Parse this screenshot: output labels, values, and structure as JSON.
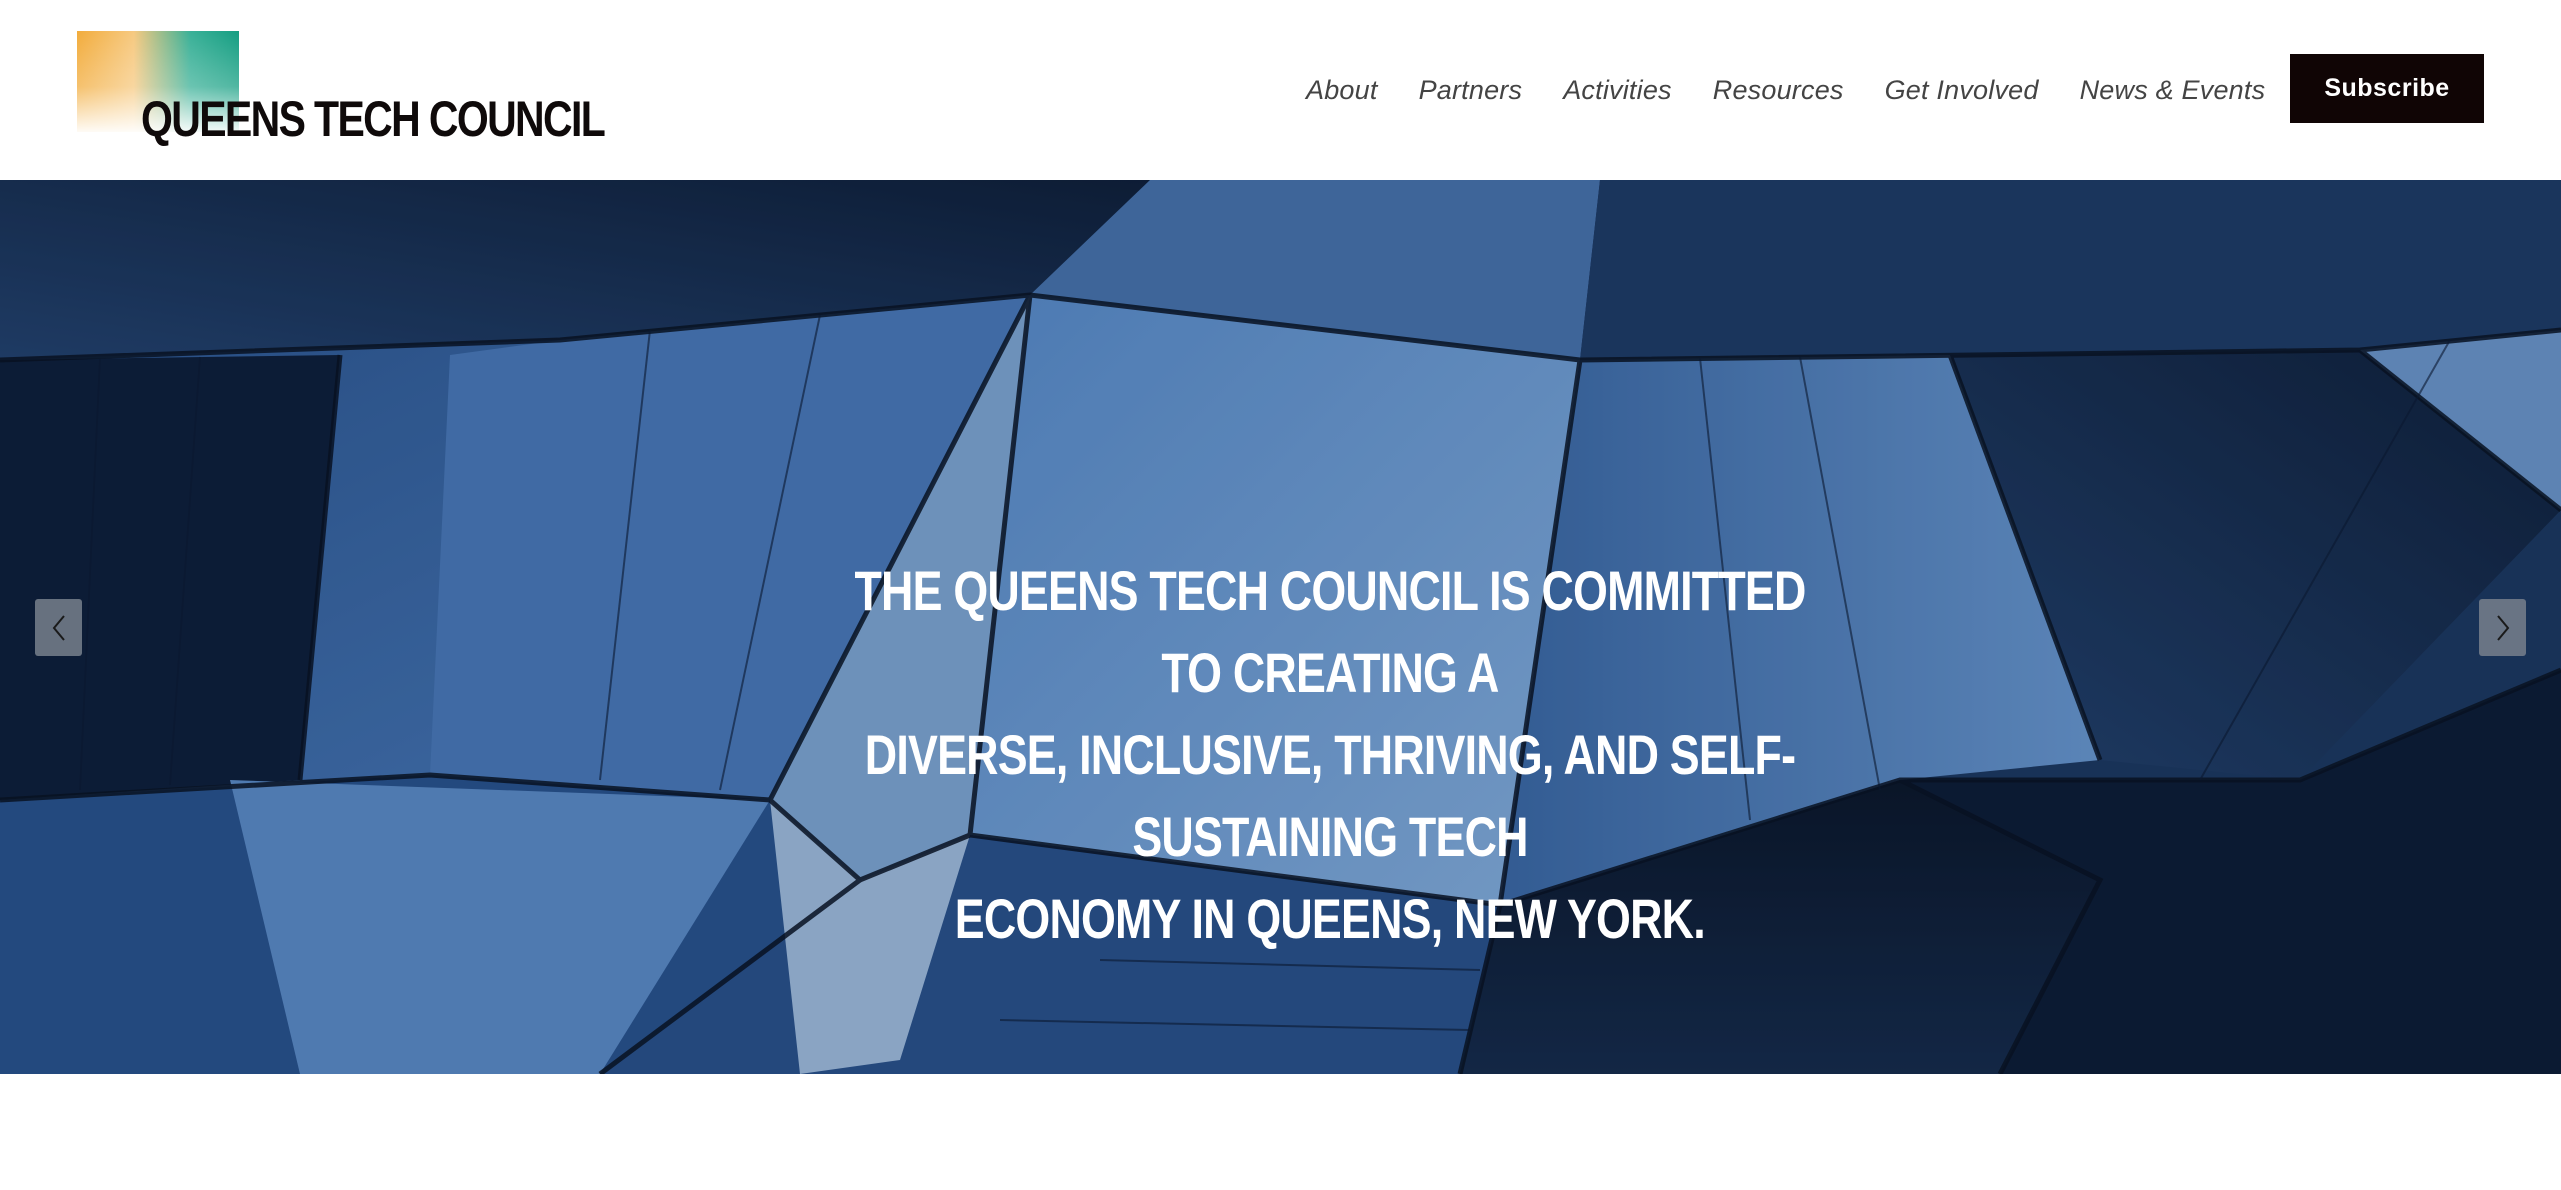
{
  "brand": {
    "name": "QUEENS TECH COUNCIL",
    "logo_icon": "gradient-square-logo"
  },
  "nav": {
    "items": [
      "About",
      "Partners",
      "Activities",
      "Resources",
      "Get Involved",
      "News & Events"
    ],
    "subscribe_label": "Subscribe"
  },
  "hero": {
    "lines": [
      "THE QUEENS TECH COUNCIL IS COMMITTED TO CREATING A",
      "DIVERSE, INCLUSIVE, THRIVING, AND SELF-SUSTAINING TECH",
      "ECONOMY IN QUEENS, NEW YORK."
    ],
    "prev_icon": "chevron-left-icon",
    "next_icon": "chevron-right-icon"
  },
  "colors": {
    "subscribe_bg": "#100505",
    "logo_gradient_start": "#f2ac3c",
    "logo_gradient_end": "#159e82",
    "hero_overlay": "#0b1a33"
  }
}
